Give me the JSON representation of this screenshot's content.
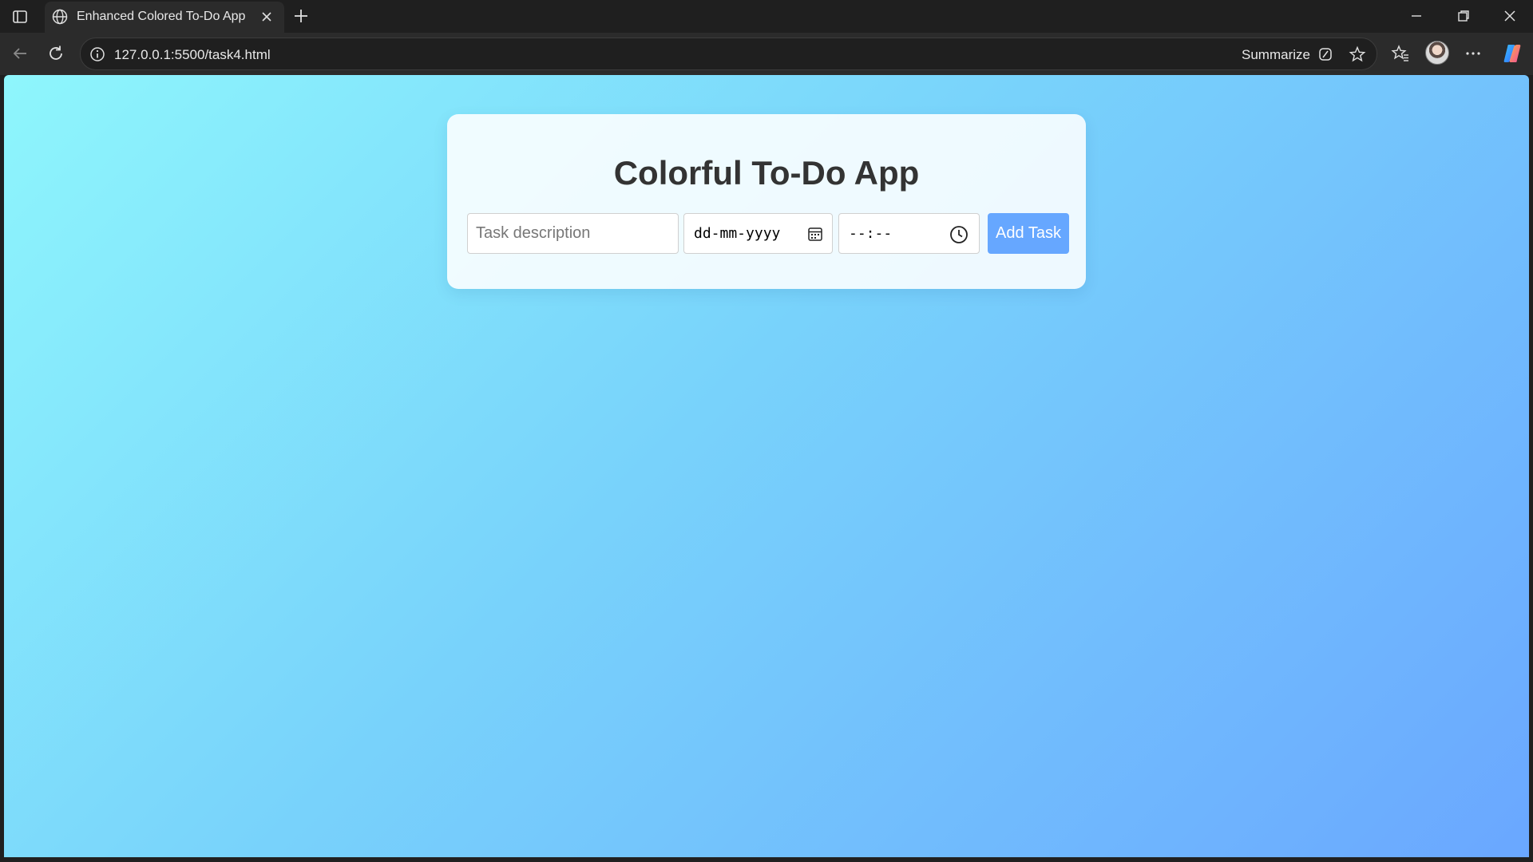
{
  "browser": {
    "tab": {
      "title": "Enhanced Colored To-Do App",
      "favicon": "globe-icon"
    },
    "address": {
      "url": "127.0.0.1:5500/task4.html"
    },
    "toolbar": {
      "summarize_label": "Summarize"
    }
  },
  "app": {
    "title": "Colorful To-Do App",
    "task_input": {
      "placeholder": "Task description",
      "value": ""
    },
    "date_input": {
      "placeholder": "dd-mm-yyyy",
      "icon": "calendar-icon"
    },
    "time_input": {
      "placeholder": "--:--",
      "icon": "clock-icon"
    },
    "add_button_label": "Add Task"
  },
  "colors": {
    "gradient_start": "#8ef6fc",
    "gradient_end": "#6aa7ff",
    "button": "#66a7ff",
    "title_text": "#333333"
  }
}
